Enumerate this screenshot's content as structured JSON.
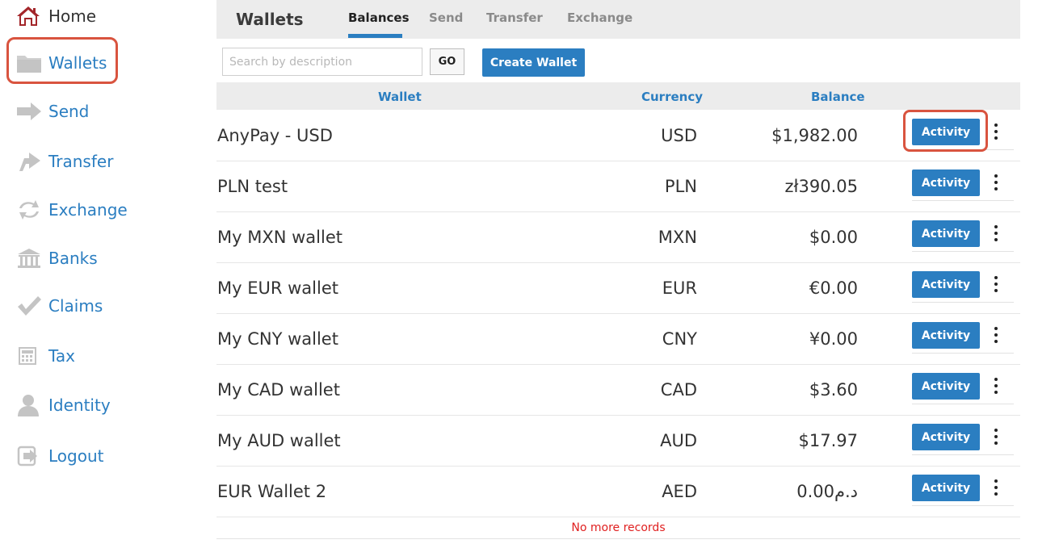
{
  "sidebar": {
    "items": [
      {
        "label": "Home",
        "icon": "home-icon"
      },
      {
        "label": "Wallets",
        "icon": "folder-icon"
      },
      {
        "label": "Send",
        "icon": "arrow-right-icon"
      },
      {
        "label": "Transfer",
        "icon": "transfer-icon"
      },
      {
        "label": "Exchange",
        "icon": "exchange-icon"
      },
      {
        "label": "Banks",
        "icon": "bank-icon"
      },
      {
        "label": "Claims",
        "icon": "check-icon"
      },
      {
        "label": "Tax",
        "icon": "calculator-icon"
      },
      {
        "label": "Identity",
        "icon": "user-icon"
      },
      {
        "label": "Logout",
        "icon": "logout-icon"
      }
    ],
    "active": "Wallets"
  },
  "header": {
    "title": "Wallets",
    "tabs": [
      {
        "label": "Balances",
        "active": true
      },
      {
        "label": "Send"
      },
      {
        "label": "Transfer"
      },
      {
        "label": "Exchange"
      }
    ]
  },
  "toolbar": {
    "search_placeholder": "Search by description",
    "search_value": "",
    "go_label": "GO",
    "create_label": "Create Wallet"
  },
  "table": {
    "columns": [
      "Wallet",
      "Currency",
      "Balance"
    ],
    "activity_label": "Activity",
    "rows": [
      {
        "wallet": "AnyPay - USD",
        "currency": "USD",
        "balance": "$1,982.00"
      },
      {
        "wallet": "PLN test",
        "currency": "PLN",
        "balance": "zł390.05"
      },
      {
        "wallet": "My MXN wallet",
        "currency": "MXN",
        "balance": "$0.00"
      },
      {
        "wallet": "My EUR wallet",
        "currency": "EUR",
        "balance": "€0.00"
      },
      {
        "wallet": "My CNY wallet",
        "currency": "CNY",
        "balance": "¥0.00"
      },
      {
        "wallet": "My CAD wallet",
        "currency": "CAD",
        "balance": "$3.60"
      },
      {
        "wallet": "My AUD wallet",
        "currency": "AUD",
        "balance": "$17.97"
      },
      {
        "wallet": "EUR Wallet 2",
        "currency": "AED",
        "balance": "د.م0.00"
      }
    ],
    "footer": "No more records"
  },
  "colors": {
    "accent": "#2b7ec1",
    "highlight": "#d9543f",
    "header_bg": "#ececec",
    "home_icon": "#a3262a",
    "icon_gray": "#c4c4c4",
    "no_more": "#e02020"
  }
}
